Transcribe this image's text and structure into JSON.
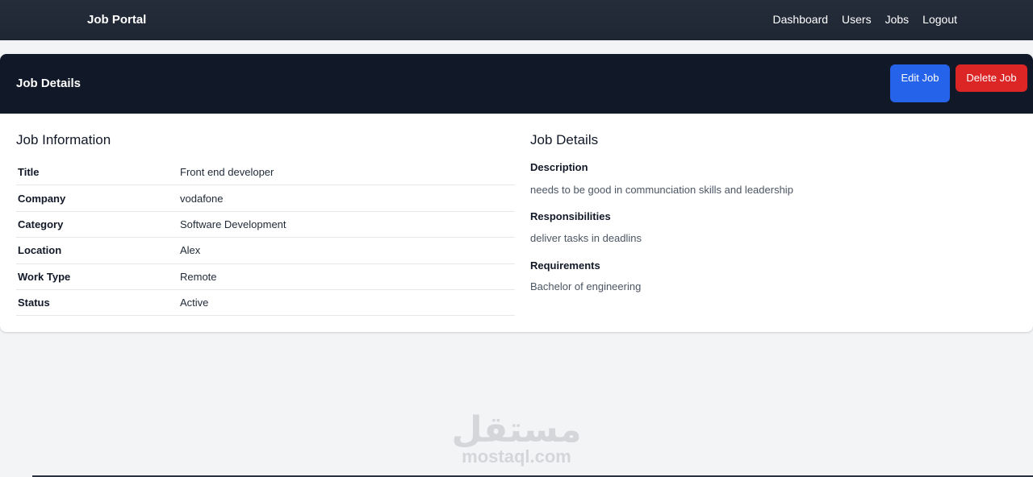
{
  "navbar": {
    "brand": "Job Portal",
    "links": [
      "Dashboard",
      "Users",
      "Jobs",
      "Logout"
    ]
  },
  "card": {
    "header_title": "Job Details",
    "edit_label": "Edit Job",
    "delete_label": "Delete Job",
    "info": {
      "heading": "Job Information",
      "rows": [
        {
          "label": "Title",
          "value": "Front end developer"
        },
        {
          "label": "Company",
          "value": "vodafone"
        },
        {
          "label": "Category",
          "value": "Software Development"
        },
        {
          "label": "Location",
          "value": "Alex"
        },
        {
          "label": "Work Type",
          "value": "Remote"
        },
        {
          "label": "Status",
          "value": "Active"
        }
      ]
    },
    "details": {
      "heading": "Job Details",
      "sections": [
        {
          "label": "Description",
          "text": "needs to be good in communciation skills and leadership"
        },
        {
          "label": "Responsibilities",
          "text": "deliver tasks in deadlins"
        },
        {
          "label": "Requirements",
          "text": "Bachelor of engineering"
        }
      ]
    }
  },
  "watermark": {
    "arabic": "مستقل",
    "latin": "mostaql.com"
  },
  "colors": {
    "navbar": "#1f2633",
    "card_header": "#111827",
    "page_background": "#f3f4f6",
    "edit_button": "#2563eb",
    "delete_button": "#dc2626",
    "muted_text": "#4b5563"
  }
}
